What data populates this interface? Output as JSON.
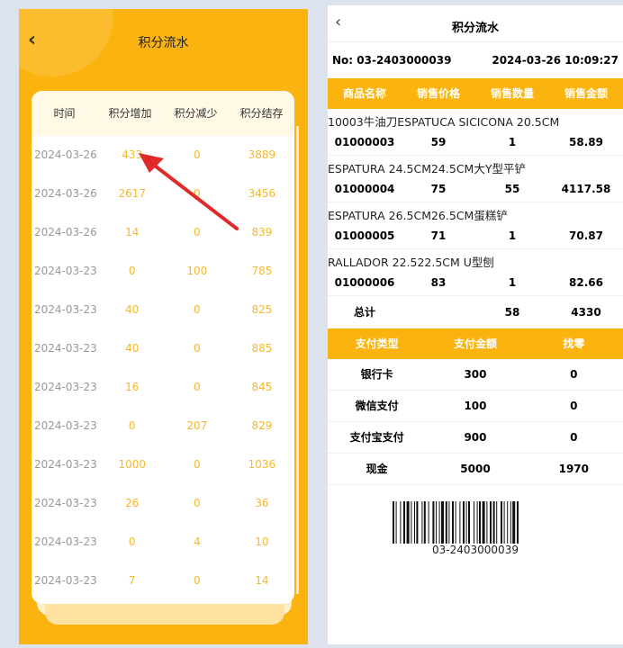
{
  "left": {
    "title": "积分流水",
    "columns": [
      "时间",
      "积分增加",
      "积分减少",
      "积分结存"
    ],
    "rows": [
      {
        "date": "2024-03-26",
        "add": "433",
        "sub": "0",
        "balance": "3889"
      },
      {
        "date": "2024-03-26",
        "add": "2617",
        "sub": "0",
        "balance": "3456"
      },
      {
        "date": "2024-03-26",
        "add": "14",
        "sub": "0",
        "balance": "839"
      },
      {
        "date": "2024-03-23",
        "add": "0",
        "sub": "100",
        "balance": "785"
      },
      {
        "date": "2024-03-23",
        "add": "40",
        "sub": "0",
        "balance": "825"
      },
      {
        "date": "2024-03-23",
        "add": "40",
        "sub": "0",
        "balance": "885"
      },
      {
        "date": "2024-03-23",
        "add": "16",
        "sub": "0",
        "balance": "845"
      },
      {
        "date": "2024-03-23",
        "add": "0",
        "sub": "207",
        "balance": "829"
      },
      {
        "date": "2024-03-23",
        "add": "1000",
        "sub": "0",
        "balance": "1036"
      },
      {
        "date": "2024-03-23",
        "add": "26",
        "sub": "0",
        "balance": "36"
      },
      {
        "date": "2024-03-23",
        "add": "0",
        "sub": "4",
        "balance": "10"
      },
      {
        "date": "2024-03-23",
        "add": "7",
        "sub": "0",
        "balance": "14"
      }
    ]
  },
  "right": {
    "title": "积分流水",
    "order_no": "No: 03-2403000039",
    "datetime": "2024-03-26 10:09:27",
    "item_columns": [
      "商品名称",
      "销售价格",
      "销售数量",
      "销售金额"
    ],
    "items": [
      {
        "name": "10003牛油刀ESPATUCA SICICONA 20.5CM",
        "code": "01000003",
        "price": "59",
        "qty": "1",
        "amount": "58.89"
      },
      {
        "name": "ESPATURA 24.5CM24.5CM大Y型平铲",
        "code": "01000004",
        "price": "75",
        "qty": "55",
        "amount": "4117.58"
      },
      {
        "name": "ESPATURA 26.5CM26.5CM蛋糕铲",
        "code": "01000005",
        "price": "71",
        "qty": "1",
        "amount": "70.87"
      },
      {
        "name": "RALLADOR 22.522.5CM U型刨",
        "code": "01000006",
        "price": "83",
        "qty": "1",
        "amount": "82.66"
      }
    ],
    "total": {
      "label": "总计",
      "qty": "58",
      "amount": "4330"
    },
    "pay_columns": [
      "支付类型",
      "支付金额",
      "找零"
    ],
    "payments": [
      {
        "type": "银行卡",
        "amount": "300",
        "change": "0"
      },
      {
        "type": "微信支付",
        "amount": "100",
        "change": "0"
      },
      {
        "type": "支付宝支付",
        "amount": "900",
        "change": "0"
      },
      {
        "type": "现金",
        "amount": "5000",
        "change": "1970"
      }
    ],
    "barcode_text": "03-2403000039"
  },
  "colors": {
    "accent": "#fbb30f",
    "number": "#f5b82e",
    "arrow": "#e02a2a"
  },
  "icons": {
    "back": "chevron-left-icon",
    "annotation": "red-arrow-icon"
  }
}
